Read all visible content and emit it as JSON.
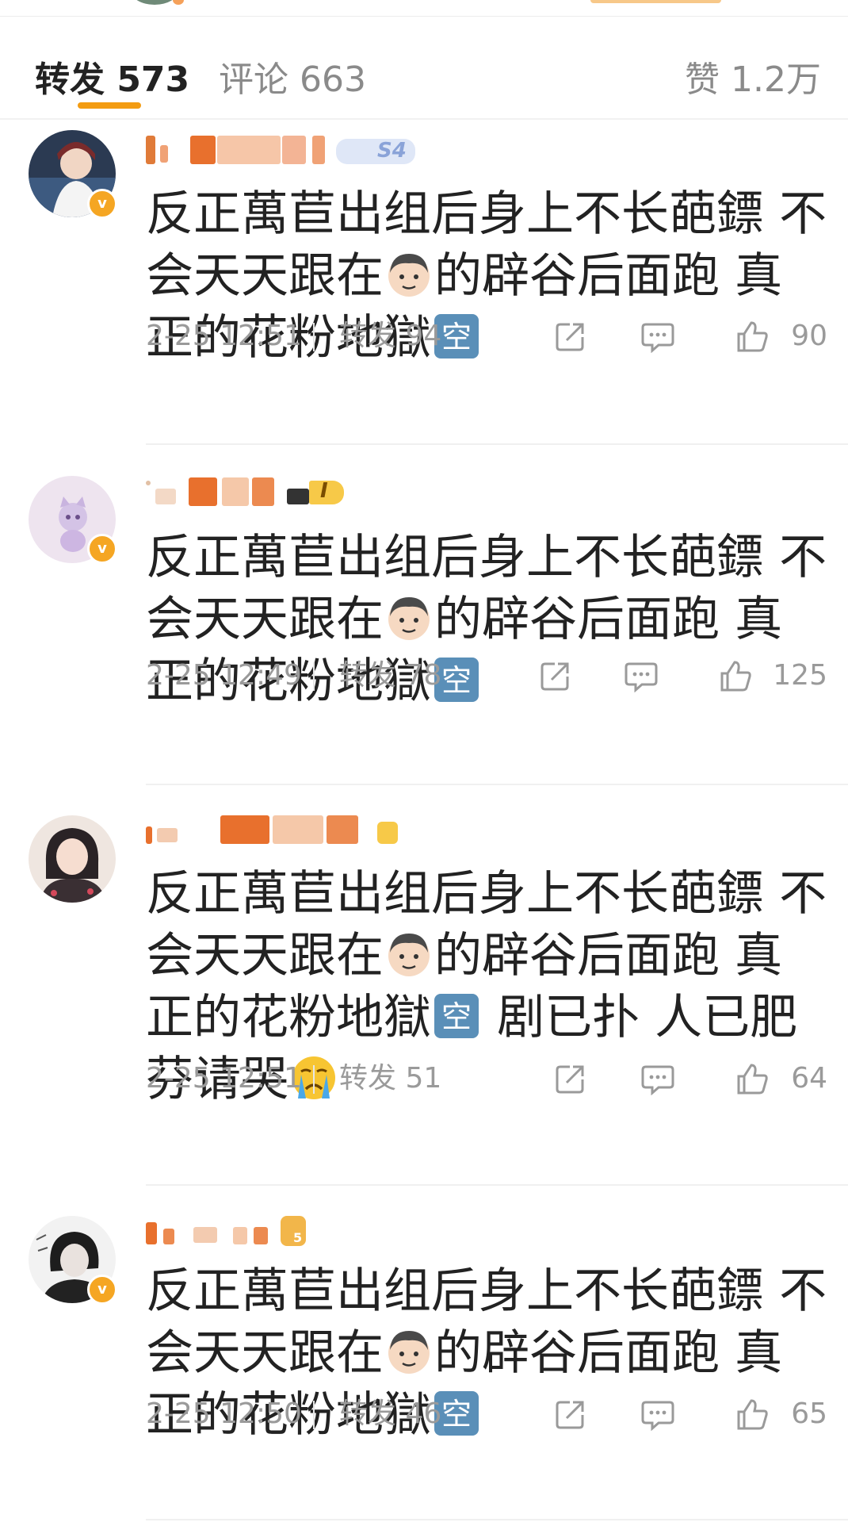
{
  "tabs": {
    "repost": "转发 573",
    "comments": "评论 663",
    "likes": "赞 1.2万"
  },
  "comments": [
    {
      "text_a": "反正萬苣出组后身上不长葩鏢 不会天天跟在",
      "text_b": "的辟谷后面跑 真正的花粉地獄",
      "text_c": "",
      "time": "2-25 12:51",
      "repost": "转发 94",
      "likes": "90",
      "badge": "S4"
    },
    {
      "text_a": "反正萬苣出组后身上不长葩鏢 不会天天跟在",
      "text_b": "的辟谷后面跑 真正的花粉地獄",
      "text_c": "",
      "time": "2-25 12:49",
      "repost": "转发 78",
      "likes": "125",
      "badge": "I"
    },
    {
      "text_a": "反正萬苣出组后身上不长葩鏢 不会天天跟在",
      "text_b": "的辟谷后面跑 真正的花粉地獄",
      "text_c": " 剧已扑 人已肥 芬请哭",
      "time": "2-25 12:51",
      "repost": "转发 51",
      "likes": "64",
      "badge": ""
    },
    {
      "text_a": "反正萬苣出组后身上不长葩鏢 不会天天跟在",
      "text_b": "的辟谷后面跑 真正的花粉地獄",
      "text_c": "",
      "time": "2-25 12:50",
      "repost": "转发 46",
      "likes": "65",
      "badge": "5"
    }
  ],
  "colors": {
    "accent": "#f39c12",
    "verified": "#f5a623",
    "text": "#222222",
    "meta": "#9a9a9a"
  },
  "icons": [
    "share-icon",
    "comment-icon",
    "thumbs-up-icon",
    "verified-badge",
    "man-face-emoji",
    "kong-emoji",
    "crying-face-emoji"
  ]
}
